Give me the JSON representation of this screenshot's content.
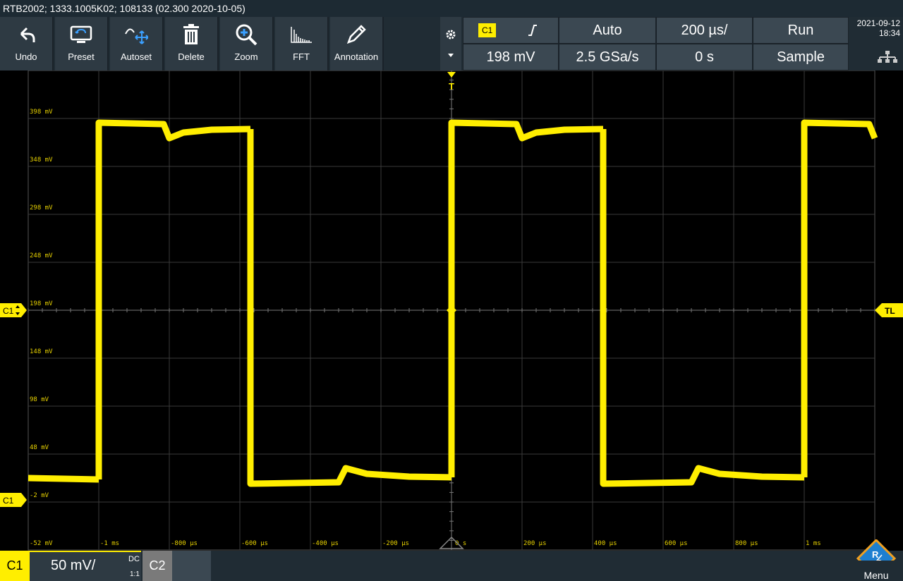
{
  "title": "RTB2002; 1333.1005K02; 108133 (02.300 2020-10-05)",
  "toolbar": {
    "buttons": [
      "Undo",
      "Preset",
      "Autoset",
      "Delete",
      "Zoom",
      "FFT",
      "Annotation"
    ]
  },
  "settings": {
    "channel": "C1",
    "trigger_slope": "rising-edge-icon",
    "trigger_mode": "Auto",
    "time_scale": "200 µs/",
    "run_state": "Run",
    "trigger_level": "198 mV",
    "sample_rate": "2.5 GSa/s",
    "time_offset": "0 s",
    "acq_mode": "Sample"
  },
  "datetime": {
    "date": "2021-09-12",
    "time": "18:34"
  },
  "plot": {
    "y_labels": [
      "398 mV",
      "348 mV",
      "298 mV",
      "248 mV",
      "198 mV",
      "148 mV",
      "98 mV",
      "48 mV",
      "-2 mV",
      "-52 mV"
    ],
    "x_labels": [
      "-1 ms",
      "-800 µs",
      "-600 µs",
      "-400 µs",
      "-200 µs",
      "0 s",
      "200 µs",
      "400 µs",
      "600 µs",
      "800 µs",
      "1 ms"
    ],
    "marker_c1_offset": "C1",
    "marker_c1_level": "C1",
    "marker_trigger_level": "TL",
    "marker_trigger": "T",
    "trace_color": "#ffee00"
  },
  "bottom": {
    "channel": "C1",
    "vscale": "50 mV/",
    "coupling": "DC",
    "probe": "1:1",
    "channel2": "C2",
    "menu": "Menu"
  }
}
